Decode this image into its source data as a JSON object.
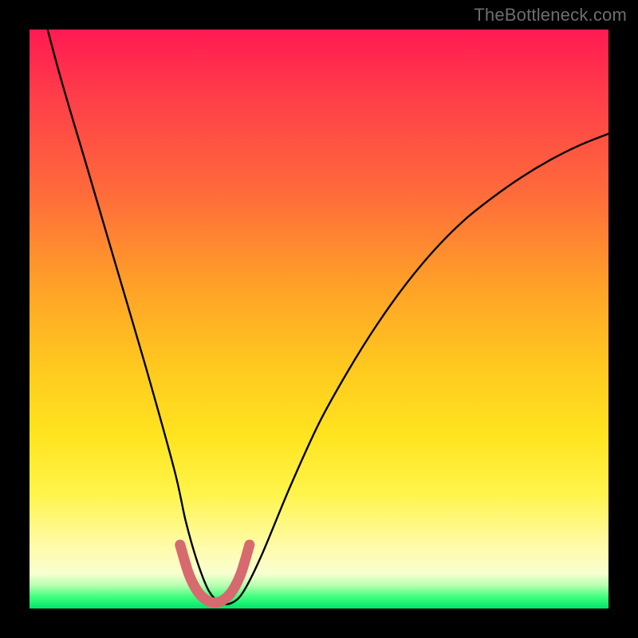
{
  "watermark": "TheBottleneck.com",
  "chart_data": {
    "type": "line",
    "title": "",
    "xlabel": "",
    "ylabel": "",
    "xlim": [
      0,
      100
    ],
    "ylim": [
      0,
      100
    ],
    "grid": false,
    "legend": false,
    "series": [
      {
        "name": "bottleneck-curve",
        "color": "#000000",
        "x": [
          0,
          5,
          10,
          15,
          20,
          25,
          27,
          29,
          31,
          33,
          35,
          37,
          40,
          45,
          50,
          55,
          60,
          65,
          70,
          75,
          80,
          85,
          90,
          95,
          100
        ],
        "y": [
          112,
          93,
          76,
          59,
          42,
          24,
          15,
          8,
          3,
          1,
          1,
          3,
          9,
          21,
          32,
          41,
          49,
          56,
          62,
          67,
          71,
          74.5,
          77.5,
          80,
          82
        ]
      },
      {
        "name": "trough-highlight",
        "color": "#d76a6e",
        "x": [
          26,
          27.5,
          29,
          30.5,
          32,
          33.5,
          35,
          36.5,
          38
        ],
        "y": [
          11,
          6,
          3,
          1.5,
          1,
          1.5,
          3,
          6,
          11
        ]
      }
    ],
    "annotations": []
  },
  "colors": {
    "curve_main": "#000000",
    "trough_highlight": "#d76a6e"
  }
}
